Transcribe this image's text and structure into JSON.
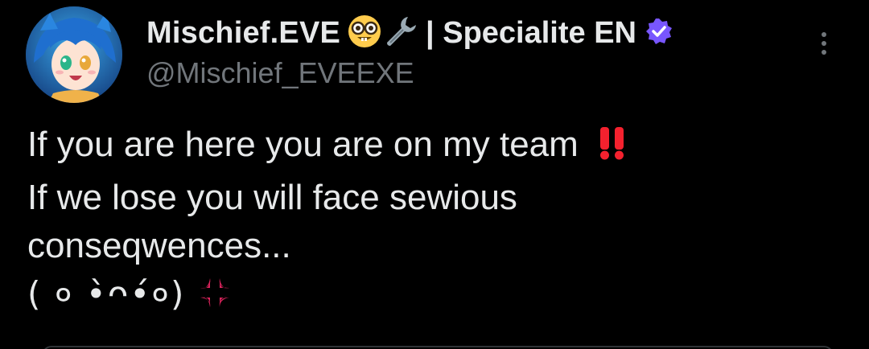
{
  "post": {
    "author": {
      "display_name": "Mischief.EVE",
      "name_emojis": [
        "nerd-face-emoji",
        "wrench-emoji"
      ],
      "name_suffix": "| Specialite EN",
      "verified_badge": "verified-badge-icon",
      "handle": "@Mischief_EVEEXE"
    },
    "more_menu_icon": "more-vertical-icon",
    "text_lines": [
      "If you are here you are on my team",
      "If we lose you will face sewious",
      "conseqwences...",
      "( ० •̀ᴖ•́०)"
    ],
    "line1_emoji": "double-exclamation-emoji",
    "line4_emoji": "anger-symbol-emoji"
  },
  "colors": {
    "background": "#000000",
    "text_primary": "#e7e9ea",
    "text_secondary": "#71767b",
    "verified_badge": "#7856ff",
    "exclamation_red": "#f4212e"
  }
}
